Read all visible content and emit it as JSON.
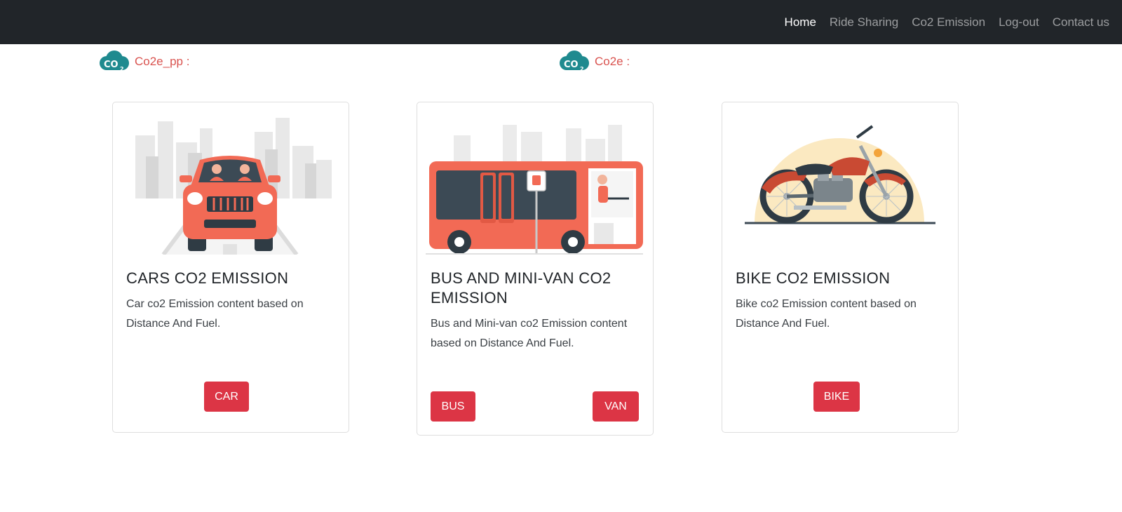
{
  "nav": {
    "links": [
      "Home",
      "Ride Sharing",
      "Co2 Emission",
      "Log-out",
      "Contact us"
    ],
    "active": "Home"
  },
  "brands": [
    {
      "icon": "co2-cloud-icon",
      "label": "Co2e_pp :"
    },
    {
      "icon": "co2-cloud-icon",
      "label": "Co2e :"
    }
  ],
  "cards": [
    {
      "title": "CARS CO2 EMISSION",
      "text": "Car co2 Emission content based on Distance And Fuel.",
      "image": "car-illustration",
      "buttons": [
        "CAR"
      ]
    },
    {
      "title": "BUS AND MINI-VAN CO2 EMISSION",
      "text": "Bus and Mini-van co2 Emission content based on Distance And Fuel.",
      "image": "bus-illustration",
      "buttons": [
        "BUS",
        "VAN"
      ]
    },
    {
      "title": "BIKE CO2 EMISSION",
      "text": "Bike co2 Emission content based on Distance And Fuel.",
      "image": "motorbike-illustration",
      "buttons": [
        "BIKE"
      ]
    }
  ],
  "colors": {
    "navbar": "#212529",
    "accent": "#dc3545",
    "brand_text": "#d9534f",
    "icon_teal": "#1f8a8f",
    "illustration_red": "#f26a55",
    "city_gray": "#e6e6e6"
  }
}
